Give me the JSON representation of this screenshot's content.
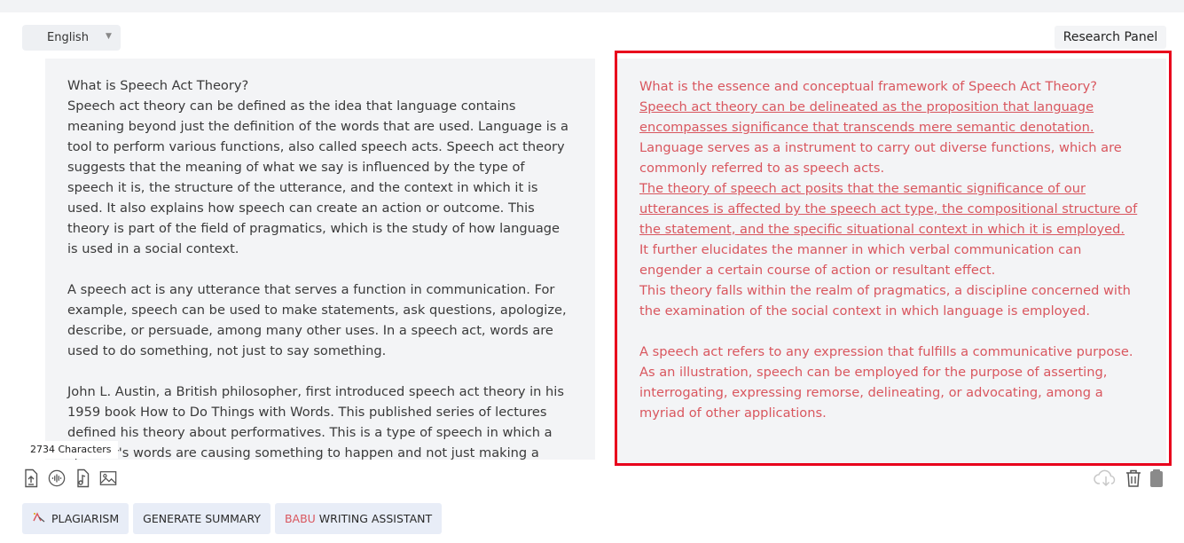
{
  "colors": {
    "accent_red": "#e8001c",
    "output_text": "#d9565e",
    "panel_bg": "#f3f4f6",
    "button_bg": "#e8edf7"
  },
  "language": {
    "selected": "English"
  },
  "research_panel_label": "Research Panel",
  "input": {
    "paragraphs": [
      "What is Speech Act Theory?",
      "Speech act theory can be defined as the idea that language contains meaning beyond just the definition of the words that are used. Language is a tool to perform various functions, also called speech acts. Speech act theory suggests that the meaning of what we say is influenced by the type of speech it is, the structure of the utterance, and the context in which it is used. It also explains how speech can create an action or outcome. This theory is part of the field of pragmatics, which is the study of how language is used in a social context.",
      "A speech act is any utterance that serves a function in communication. For example, speech can be used to make statements, ask questions, apologize, describe, or persuade, among many other uses. In a speech act, words are used to do something, not just to say something.",
      "John L. Austin, a British philosopher, first introduced speech act theory in his 1959 book How to Do Things with Words. This published series of lectures defined his theory about performatives. This is a type of speech in which a speaker's words are causing something to happen and not just making a"
    ],
    "char_count": "2734 Characters"
  },
  "output": {
    "sentences": [
      {
        "text": "What is the essence and conceptual framework of Speech Act Theory?",
        "underlined": false,
        "gap_before": false
      },
      {
        "text": "Speech act theory can be delineated as the proposition that language encompasses significance that transcends mere semantic denotation.",
        "underlined": true,
        "gap_before": false
      },
      {
        "text": "Language serves as a instrument to carry out diverse functions, which are commonly referred to as speech acts.",
        "underlined": false,
        "gap_before": false
      },
      {
        "text": "The theory of speech act posits that the semantic significance of our utterances is affected by the speech act type, the compositional structure of the statement, and the specific situational context in which it is employed.",
        "underlined": true,
        "gap_before": false
      },
      {
        "text": "It further elucidates the manner in which verbal communication can engender a certain course of action or resultant effect.",
        "underlined": false,
        "gap_before": false
      },
      {
        "text": "This theory falls within the realm of pragmatics, a discipline concerned with the examination of the social context in which language is employed.",
        "underlined": false,
        "gap_before": false
      },
      {
        "text": "A speech act refers to any expression that fulfills a communicative purpose.",
        "underlined": false,
        "gap_before": true
      },
      {
        "text": "As an illustration, speech can be employed for the purpose of asserting, interrogating, expressing remorse, delineating, or advocating, among a myriad of other applications.",
        "underlined": false,
        "gap_before": false
      }
    ]
  },
  "tool_icons": [
    "upload-file-icon",
    "audio-wave-icon",
    "music-file-icon",
    "image-icon"
  ],
  "right_icons": [
    "cloud-download-icon",
    "trash-icon",
    "clipboard-icon"
  ],
  "buttons": {
    "plagiarism": "PLAGIARISM",
    "summary": "GENERATE SUMMARY",
    "assistant_brand": "BABU",
    "assistant_rest": " WRITING ASSISTANT"
  }
}
